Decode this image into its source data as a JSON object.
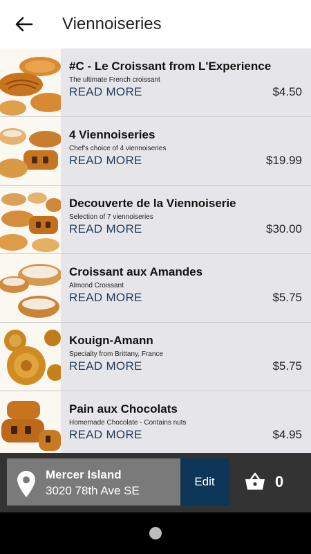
{
  "header": {
    "title": "Viennoiseries",
    "back_icon": "arrow-left-icon"
  },
  "items": [
    {
      "name": "#C - Le Croissant from L'Experience",
      "description": "The ultimate French croissant",
      "read_more": "READ MORE",
      "price": "$4.50",
      "image": "croissants-photo"
    },
    {
      "name": "4 Viennoiseries",
      "description": "Chef's choice of 4 viennoiseries",
      "read_more": "READ MORE",
      "price": "$19.99",
      "image": "assorted-pastries-photo"
    },
    {
      "name": "Decouverte de la Viennoiserie",
      "description": "Selection of 7 viennoiseries",
      "read_more": "READ MORE",
      "price": "$30.00",
      "image": "pastry-selection-photo"
    },
    {
      "name": "Croissant aux Amandes",
      "description": "Almond Croissant",
      "read_more": "READ MORE",
      "price": "$5.75",
      "image": "almond-croissant-photo"
    },
    {
      "name": "Kouign-Amann",
      "description": "Specialty from Brittany, France",
      "read_more": "READ MORE",
      "price": "$5.75",
      "image": "kouign-amann-photo"
    },
    {
      "name": "Pain aux Chocolats",
      "description": "Homemade Chocolate - Contains nuts",
      "read_more": "READ MORE",
      "price": "$4.95",
      "image": "pain-au-chocolat-photo"
    }
  ],
  "store": {
    "name": "Mercer Island",
    "address": "3020 78th Ave SE",
    "edit_label": "Edit",
    "pin_icon": "location-pin-icon"
  },
  "cart": {
    "count": "0",
    "icon": "basket-icon"
  },
  "colors": {
    "list_bg": "#e6e6ea",
    "read_more": "#1e3a5c",
    "bottom_bar": "#333333",
    "store_box": "#7a7a7a",
    "edit_button": "#0d3557"
  }
}
